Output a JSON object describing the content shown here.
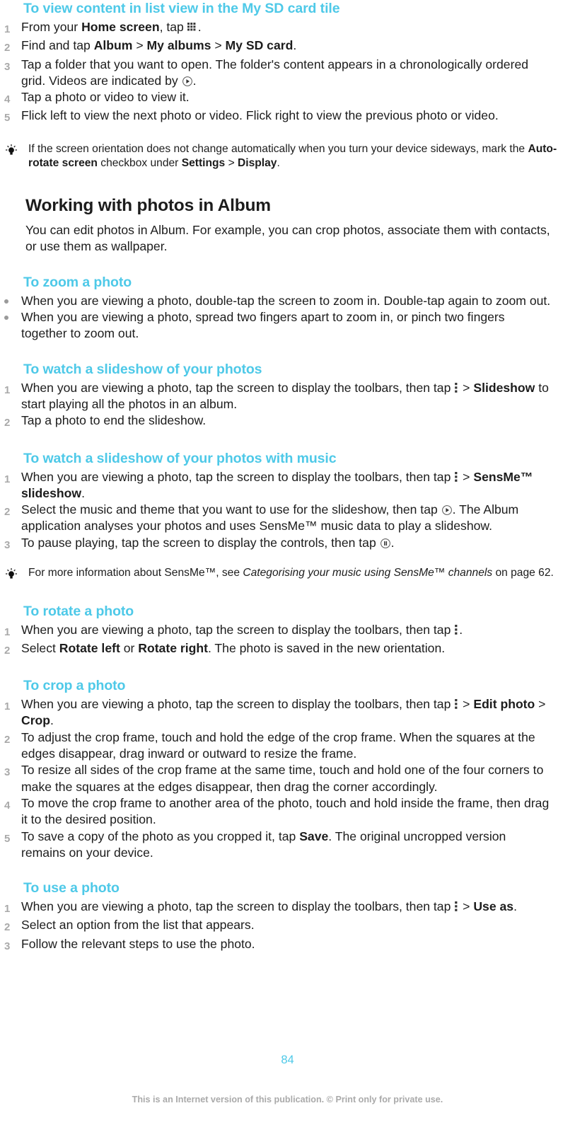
{
  "document": {
    "page_number": "84",
    "footer_note": "This is an Internet version of this publication. © Print only for private use.",
    "heading_color": "#4ec9e8",
    "body_color": "#1c1c1c",
    "number_color": "#a9a9a9"
  },
  "sections": {
    "list_view": {
      "heading": "To view content in list view in the My SD card tile",
      "steps": [
        {
          "num": "1",
          "prefix": "From your ",
          "bold1": "Home screen",
          "mid": ", tap ",
          "icon": "grid-icon",
          "suffix": "."
        },
        {
          "num": "2",
          "prefix": "Find and tap ",
          "bold1": "Album",
          "sep1": " > ",
          "bold2": "My albums",
          "sep2": " > ",
          "bold3": "My SD card",
          "suffix": "."
        },
        {
          "num": "3",
          "text_a": "Tap a folder that you want to open. The folder's content appears in a chronologically ordered grid. Videos are indicated by ",
          "icon": "play-icon",
          "text_b": "."
        },
        {
          "num": "4",
          "text": "Tap a photo or video to view it."
        },
        {
          "num": "5",
          "text": "Flick left to view the next photo or video. Flick right to view the previous photo or video."
        }
      ]
    },
    "tip_rotate": {
      "icon": "lightbulb-icon",
      "text_a": "If the screen orientation does not change automatically when you turn your device sideways, mark the ",
      "bold1": "Auto-rotate screen",
      "text_b": " checkbox under ",
      "bold2": "Settings",
      "text_c": " > ",
      "bold3": "Display",
      "text_d": "."
    },
    "working_with_photos": {
      "heading": "Working with photos in Album",
      "paragraph": "You can edit photos in Album. For example, you can crop photos, associate them with contacts, or use them as wallpaper."
    },
    "zoom_photo": {
      "heading": "To zoom a photo",
      "bullets": [
        "When you are viewing a photo, double-tap the screen to zoom in. Double-tap again to zoom out.",
        "When you are viewing a photo, spread two fingers apart to zoom in, or pinch two fingers together to zoom out."
      ]
    },
    "slideshow": {
      "heading": "To watch a slideshow of your photos",
      "steps": [
        {
          "num": "1",
          "text_a": "When you are viewing a photo, tap the screen to display the toolbars, then tap ",
          "icon": "overflow-menu-icon",
          "text_b": " > ",
          "bold": "Slideshow",
          "text_c": " to start playing all the photos in an album."
        },
        {
          "num": "2",
          "text": "Tap a photo to end the slideshow."
        }
      ]
    },
    "slideshow_music": {
      "heading": "To watch a slideshow of your photos with music",
      "steps": [
        {
          "num": "1",
          "text_a": "When you are viewing a photo, tap the screen to display the toolbars, then tap ",
          "icon": "overflow-menu-icon",
          "text_b": " > ",
          "bold": "SensMe™ slideshow",
          "text_c": "."
        },
        {
          "num": "2",
          "text_a": "Select the music and theme that you want to use for the slideshow, then tap ",
          "icon": "play-icon",
          "text_b": ". The Album application analyses your photos and uses SensMe™ music data to play a slideshow."
        },
        {
          "num": "3",
          "text_a": "To pause playing, tap the screen to display the controls, then tap ",
          "icon": "pause-icon",
          "text_b": "."
        }
      ]
    },
    "tip_sensme": {
      "icon": "lightbulb-icon",
      "text_a": "For more information about SensMe™, see ",
      "italic": "Categorising your music using SensMe™ channels",
      "text_b": " on page 62."
    },
    "rotate_photo": {
      "heading": "To rotate a photo",
      "steps": [
        {
          "num": "1",
          "text_a": "When you are viewing a photo, tap the screen to display the toolbars, then tap ",
          "icon": "overflow-menu-icon",
          "text_b": "."
        },
        {
          "num": "2",
          "text_a": "Select ",
          "bold1": "Rotate left",
          "text_b": " or ",
          "bold2": "Rotate right",
          "text_c": ". The photo is saved in the new orientation."
        }
      ]
    },
    "crop_photo": {
      "heading": "To crop a photo",
      "steps": [
        {
          "num": "1",
          "text_a": "When you are viewing a photo, tap the screen to display the toolbars, then tap ",
          "icon": "overflow-menu-icon",
          "text_b": " > ",
          "bold1": "Edit photo",
          "text_c": " > ",
          "bold2": "Crop",
          "text_d": "."
        },
        {
          "num": "2",
          "text": "To adjust the crop frame, touch and hold the edge of the crop frame. When the squares at the edges disappear, drag inward or outward to resize the frame."
        },
        {
          "num": "3",
          "text": "To resize all sides of the crop frame at the same time, touch and hold one of the four corners to make the squares at the edges disappear, then drag the corner accordingly."
        },
        {
          "num": "4",
          "text": "To move the crop frame to another area of the photo, touch and hold inside the frame, then drag it to the desired position."
        },
        {
          "num": "5",
          "text_a": "To save a copy of the photo as you cropped it, tap ",
          "bold1": "Save",
          "text_b": ". The original uncropped version remains on your device."
        }
      ]
    },
    "use_photo": {
      "heading": "To use a photo",
      "steps": [
        {
          "num": "1",
          "text_a": "When you are viewing a photo, tap the screen to display the toolbars, then tap ",
          "icon": "overflow-menu-icon",
          "text_b": " > ",
          "bold1": "Use as",
          "text_c": "."
        },
        {
          "num": "2",
          "text": "Select an option from the list that appears."
        },
        {
          "num": "3",
          "text": "Follow the relevant steps to use the photo."
        }
      ]
    }
  }
}
